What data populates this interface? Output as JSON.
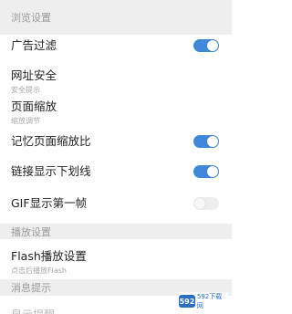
{
  "sections": {
    "browse": {
      "title": "浏览设置"
    },
    "plugins": {
      "title": "播放设置"
    },
    "notifications": {
      "title": "消息提示"
    }
  },
  "browse_items": [
    {
      "title": "广告过滤",
      "subtitle": "",
      "toggle": true
    },
    {
      "title": "网址安全",
      "subtitle": "安全提示",
      "toggle": null
    },
    {
      "title": "页面缩放",
      "subtitle": "缩放调节",
      "toggle": null
    },
    {
      "title": "记忆页面缩放比",
      "subtitle": "",
      "toggle": true
    },
    {
      "title": "链接显示下划线",
      "subtitle": "",
      "toggle": true
    },
    {
      "title": "GIF显示第一帧",
      "subtitle": "",
      "toggle": false
    }
  ],
  "plugin_items": [
    {
      "title": "Flash播放设置",
      "subtitle": "点击后播放Flash"
    }
  ],
  "cut_row": {
    "title": "显示提醒"
  },
  "watermark": {
    "logo": "592",
    "text": "592下载网"
  },
  "colors": {
    "accent": "#3f88d8",
    "section_bg": "#eeeeee",
    "section_text": "#9a9a9a"
  }
}
